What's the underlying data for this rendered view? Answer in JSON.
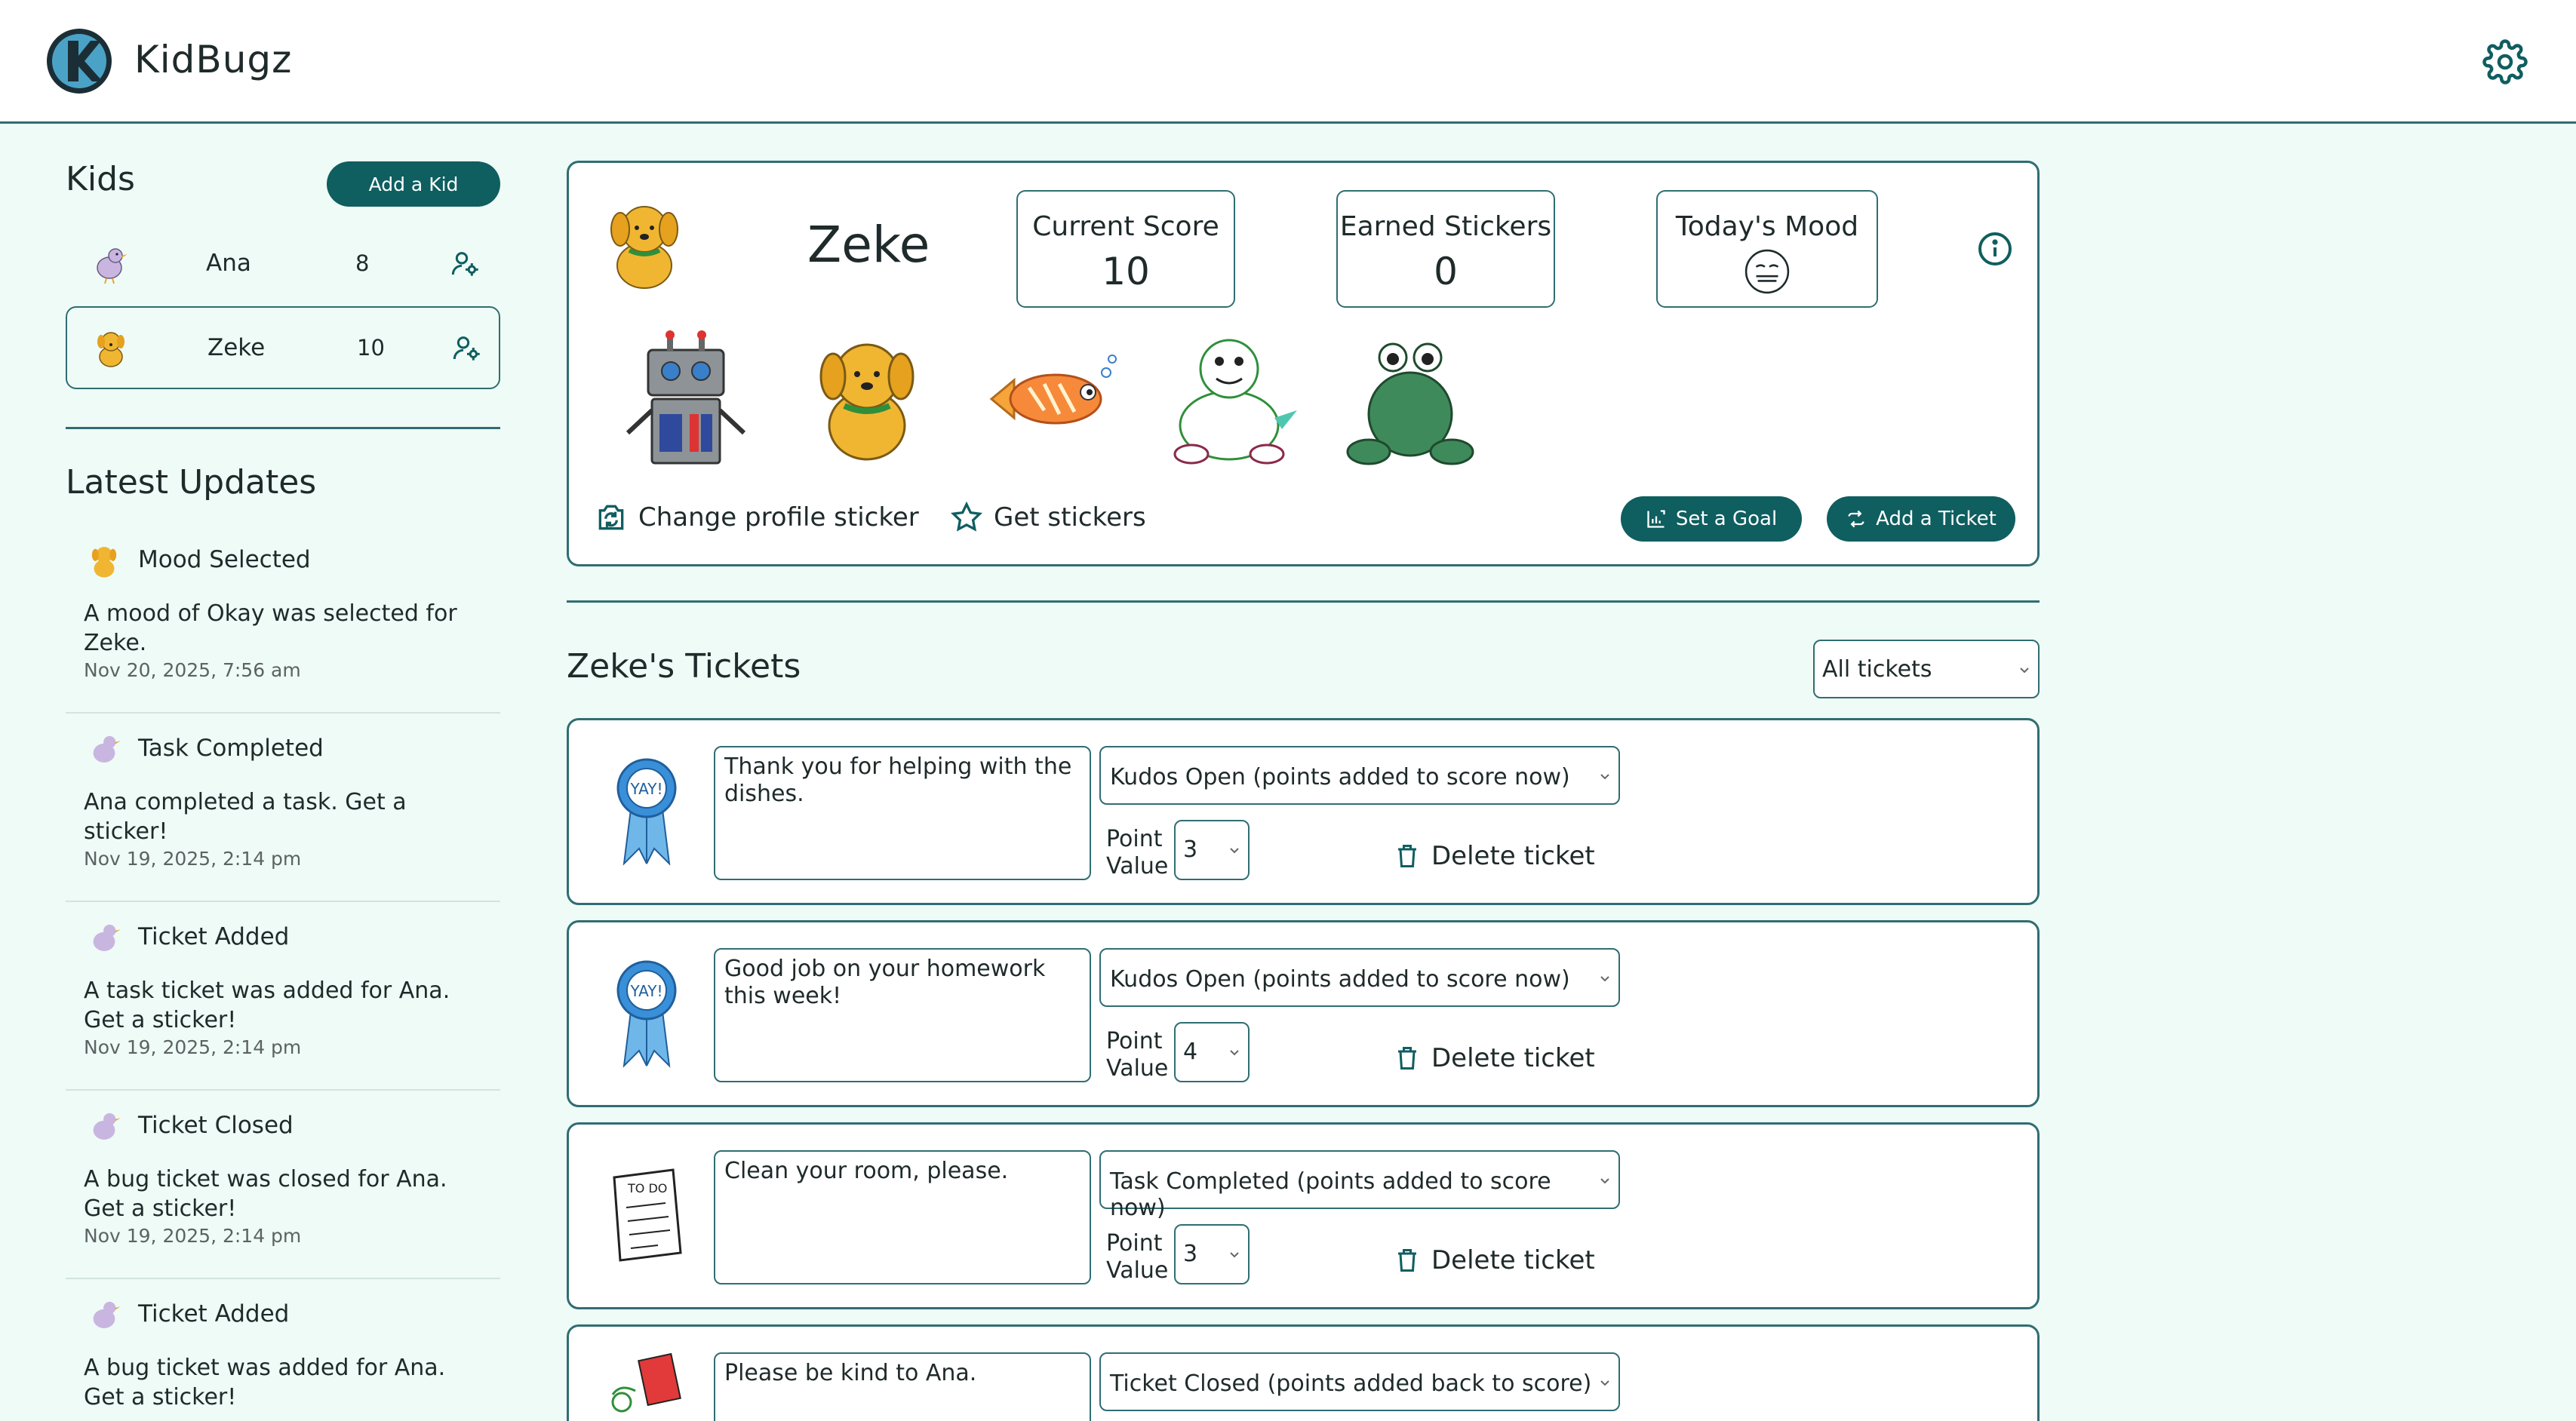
{
  "app": {
    "name": "KidBugz"
  },
  "sidebar": {
    "kids_title": "Kids",
    "add_kid_label": "Add a Kid",
    "kids": [
      {
        "name": "Ana",
        "score": "8",
        "avatar": "bird-icon",
        "selected": false
      },
      {
        "name": "Zeke",
        "score": "10",
        "avatar": "dog-icon",
        "selected": true
      }
    ],
    "updates_title": "Latest Updates",
    "updates": [
      {
        "icon": "dog-icon",
        "title": "Mood Selected",
        "message": "A mood of Okay was selected for Zeke.",
        "date": "Nov 20, 2025, 7:56 am"
      },
      {
        "icon": "bird-icon",
        "title": "Task Completed",
        "message": "Ana completed a task. Get a sticker!",
        "date": "Nov 19, 2025, 2:14 pm"
      },
      {
        "icon": "bird-icon",
        "title": "Ticket Added",
        "message": "A task ticket was added for Ana. Get a sticker!",
        "date": "Nov 19, 2025, 2:14 pm"
      },
      {
        "icon": "bird-icon",
        "title": "Ticket Closed",
        "message": "A bug ticket was closed for Ana. Get a sticker!",
        "date": "Nov 19, 2025, 2:14 pm"
      },
      {
        "icon": "bird-icon",
        "title": "Ticket Added",
        "message": "A bug ticket was added for Ana. Get a sticker!",
        "date": ""
      }
    ]
  },
  "profile": {
    "name": "Zeke",
    "current_score_label": "Current Score",
    "current_score": "10",
    "earned_stickers_label": "Earned Stickers",
    "earned_stickers": "0",
    "mood_label": "Today's Mood",
    "mood_icon": "neutral-face-icon",
    "stickers": [
      "robot-sticker",
      "dog-sticker",
      "fish-sticker",
      "turtle-sticker",
      "frog-sticker"
    ],
    "change_sticker_label": "Change profile sticker",
    "get_stickers_label": "Get stickers",
    "set_goal_label": "Set a Goal",
    "add_ticket_label": "Add a Ticket"
  },
  "tickets": {
    "title": "Zeke's Tickets",
    "filter_value": "All tickets",
    "point_value_label": "Point Value",
    "delete_label": "Delete ticket",
    "items": [
      {
        "icon": "ribbon-icon",
        "text": "Thank you for helping with the dishes.",
        "status": "Kudos Open (points added to score now)",
        "points": "3"
      },
      {
        "icon": "ribbon-icon",
        "text": "Good job on your homework this week!",
        "status": "Kudos Open (points added to score now)",
        "points": "4"
      },
      {
        "icon": "todo-list-icon",
        "text": "Clean your room, please.",
        "status": "Task Completed (points added to score now)",
        "points": "3"
      },
      {
        "icon": "bug-icon",
        "text": "Please be kind to Ana.",
        "status": "Ticket Closed (points added back to score)",
        "points": ""
      }
    ]
  },
  "colors": {
    "accent": "#0f5e60",
    "background": "#effbf6",
    "border": "#2f6e72"
  }
}
